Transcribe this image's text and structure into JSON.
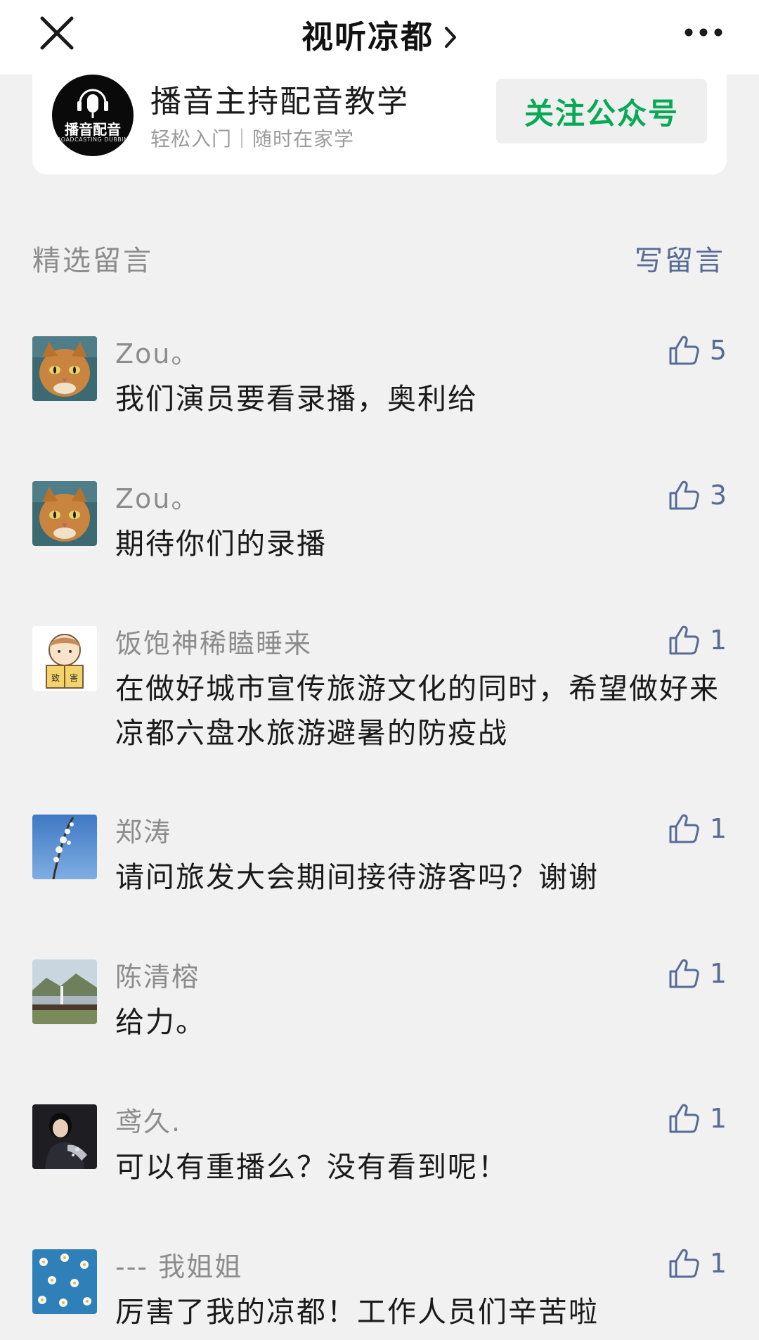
{
  "nav": {
    "title": "视听凉都",
    "close_icon": "close-icon",
    "more_icon": "more-icon"
  },
  "account": {
    "name": "播音主持配音教学",
    "description": "轻松入门｜随时在家学",
    "avatar_brand": "播音配音",
    "avatar_brand_sub": "BROADCASTING DUBBING",
    "follow_label": "关注公众号"
  },
  "comments_section": {
    "title": "精选留言",
    "write_label": "写留言"
  },
  "comments": [
    {
      "nickname": "Zou。",
      "content": "我们演员要看录播，奥利给",
      "likes": "5",
      "avatar": "orange-cat-avatar"
    },
    {
      "nickname": "Zou。",
      "content": "期待你们的录播",
      "likes": "3",
      "avatar": "orange-cat-avatar"
    },
    {
      "nickname": "饭饱神稀瞌睡来",
      "content": "在做好城市宣传旅游文化的同时，希望做好来凉都六盘水旅游避暑的防疫战",
      "likes": "1",
      "avatar": "cartoon-reader-avatar"
    },
    {
      "nickname": "郑涛",
      "content": "请问旅发大会期间接待游客吗？谢谢",
      "likes": "1",
      "avatar": "blossom-sky-avatar"
    },
    {
      "nickname": "陈清榕",
      "content": "给力。",
      "likes": "1",
      "avatar": "landscape-avatar"
    },
    {
      "nickname": "鸢久.",
      "content": "可以有重播么？没有看到呢！",
      "likes": "1",
      "avatar": "performer-avatar"
    },
    {
      "nickname": "--- 我姐姐",
      "content": "厉害了我的凉都！工作人员们辛苦啦",
      "likes": "1",
      "avatar": "daisies-avatar"
    }
  ],
  "colors": {
    "background": "#f1f1f1",
    "link_blue": "#576b95",
    "follow_green": "#07a957",
    "muted_gray": "#8c8c8c"
  }
}
